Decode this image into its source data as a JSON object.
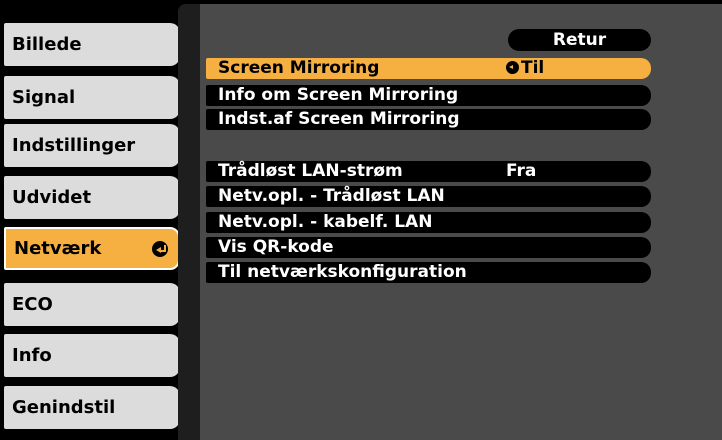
{
  "sidebar": {
    "items": [
      {
        "label": "Billede"
      },
      {
        "label": "Signal"
      },
      {
        "label": "Indstillinger"
      },
      {
        "label": "Udvidet"
      },
      {
        "label": "Netværk",
        "active": true
      },
      {
        "label": "ECO"
      },
      {
        "label": "Info"
      },
      {
        "label": "Genindstil"
      }
    ]
  },
  "panel": {
    "return_label": "Retur",
    "rows": [
      {
        "label": "Screen Mirroring",
        "value": "Til",
        "selected": true
      },
      {
        "label": "Info om Screen Mirroring"
      },
      {
        "label": "Indst.af Screen Mirroring"
      },
      {
        "label": "Trådløst LAN-strøm",
        "value": "Fra"
      },
      {
        "label": "Netv.opl. - Trådløst LAN"
      },
      {
        "label": "Netv.opl. - kabelf. LAN"
      },
      {
        "label": "Vis QR-kode"
      },
      {
        "label": "Til netværkskonfiguration"
      }
    ]
  },
  "colors": {
    "highlight": "#f5b041",
    "panel": "#4a4a4a",
    "sidebar_item": "#dcdcdc"
  }
}
